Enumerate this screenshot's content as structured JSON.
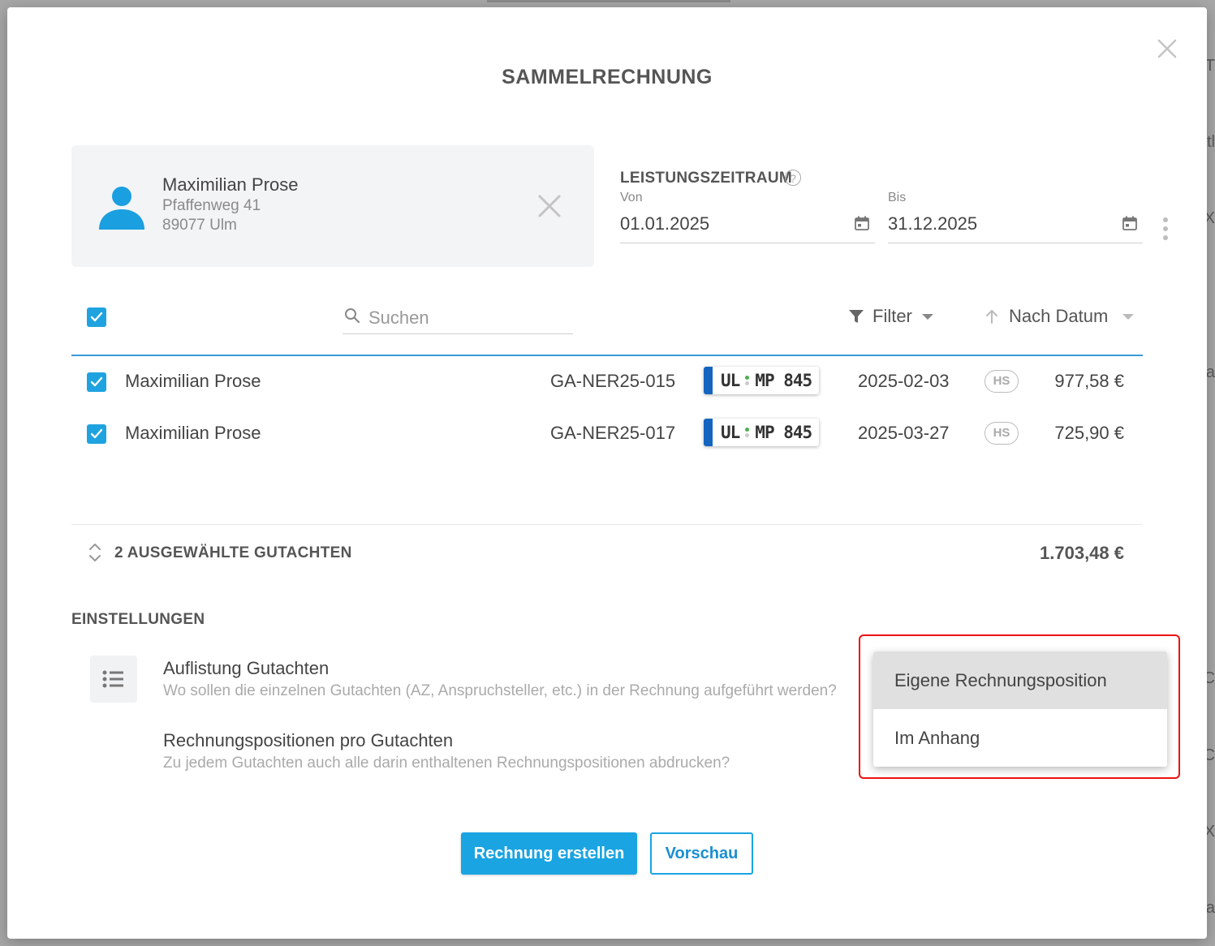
{
  "dialog": {
    "title": "SAMMELRECHNUNG"
  },
  "client": {
    "name": "Maximilian Prose",
    "street": "Pfaffenweg 41",
    "city": "89077 Ulm"
  },
  "period": {
    "label": "LEISTUNGSZEITRAUM",
    "help": "?",
    "from_label": "Von",
    "from_value": "01.01.2025",
    "to_label": "Bis",
    "to_value": "31.12.2025"
  },
  "toolbar": {
    "search_placeholder": "Suchen",
    "filter_label": "Filter",
    "sort_label": "Nach Datum"
  },
  "reports": [
    {
      "checked": true,
      "name": "Maximilian Prose",
      "az": "GA-NER25-015",
      "plate_left": "UL",
      "plate_right": "MP 845",
      "date": "2025-02-03",
      "badge": "HS",
      "amount": "977,58 €"
    },
    {
      "checked": true,
      "name": "Maximilian Prose",
      "az": "GA-NER25-017",
      "plate_left": "UL",
      "plate_right": "MP 845",
      "date": "2025-03-27",
      "badge": "HS",
      "amount": "725,90 €"
    }
  ],
  "summary": {
    "label": "2 AUSGEWÄHLTE GUTACHTEN",
    "total": "1.703,48 €"
  },
  "settings": {
    "title": "EINSTELLUNGEN",
    "listing_title": "Auflistung Gutachten",
    "listing_desc": "Wo sollen die einzelnen Gutachten (AZ, Anspruchsteller, etc.) in der Rechnung aufgeführt werden?",
    "positions_title": "Rechnungspositionen pro Gutachten",
    "positions_desc": "Zu jedem Gutachten auch alle darin enthaltenen Rechnungspositionen abdrucken?"
  },
  "dropdown": {
    "options": [
      "Eigene Rechnungsposition",
      "Im Anhang"
    ],
    "selected": "Eigene Rechnungsposition"
  },
  "actions": {
    "create_label": "Rechnung erstellen",
    "preview_label": "Vorschau"
  },
  "background_edge": [
    "T",
    "tl",
    "X",
    "a",
    "C",
    "C",
    "X",
    "a"
  ],
  "colors": {
    "accent": "#1aa4e2",
    "avatar": "#1a9fe0",
    "plate_eu": "#1565c0",
    "highlight": "#ee1111"
  }
}
